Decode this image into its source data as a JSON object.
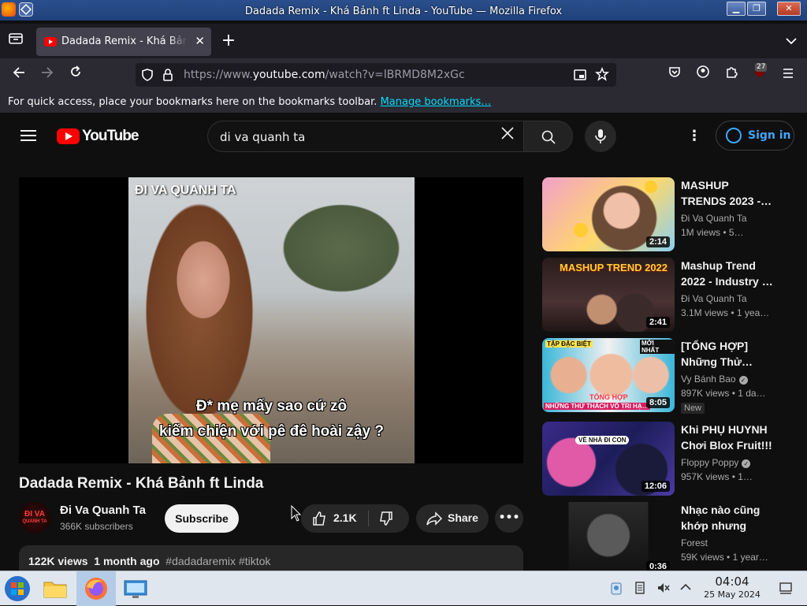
{
  "window": {
    "title": "Dadada Remix - Khá Bảnh ft Linda - YouTube — Mozilla Firefox"
  },
  "tab": {
    "label": "Dadada Remix - Khá Bảnh",
    "close": "✕",
    "new_tab": "+"
  },
  "urlbar": {
    "scheme_host_prefix": "https://www.",
    "domain": "youtube.com",
    "path": "/watch?v=lBRMD8M2xGc"
  },
  "toolbar": {
    "extensions_badge": "27"
  },
  "bookmarks": {
    "message": "For quick access, place your bookmarks here on the bookmarks toolbar.",
    "link": "Manage bookmarks…"
  },
  "youtube": {
    "logo_text": "YouTube",
    "search_query": "di va quanh ta",
    "sign_in": "Sign in"
  },
  "video": {
    "overlay_title": "ĐI VA QUANH TA",
    "subtitle_line1": "Đ* mẹ mấy sao cứ zô",
    "subtitle_line2": "kiếm chiện với pê đê hoài zậy ?",
    "title": "Dadada Remix - Khá Bảnh ft Linda",
    "channel_avatar_text_1": "ĐI VA",
    "channel_avatar_text_2": "QUANH TA",
    "channel": "Đi Va Quanh Ta",
    "subscribers": "366K subscribers",
    "subscribe": "Subscribe",
    "likes": "2.1K",
    "share": "Share",
    "more": "•••",
    "views": "122K views",
    "age": "1 month ago",
    "hashtags": "#dadadaremix #tiktok"
  },
  "recommendations": [
    {
      "title": "MASHUP TRENDS 2023 -…",
      "channel": "Đi Va Quanh Ta",
      "meta": "1M views • 5…",
      "duration": "2:14",
      "verified": false,
      "badge": ""
    },
    {
      "title": "Mashup Trend 2022 - Industry …",
      "channel": "Đi Va Quanh Ta",
      "meta": "3.1M views • 1 yea…",
      "duration": "2:41",
      "thumb_text": "MASHUP TREND 2022",
      "verified": false,
      "badge": ""
    },
    {
      "title": "[TỔNG HỢP] Những Thử…",
      "channel": "Vy Bánh Bao",
      "meta": "897K views • 1 da…",
      "duration": "8:05",
      "thumb_text_1": "TẬP ĐẶC BIỆT",
      "thumb_text_2": "MỚI NHẤT",
      "thumb_text_3": "TỔNG HỢP",
      "thumb_text_4": "NHỮNG THỬ THÁCH VÔ TRI HẠ…",
      "verified": true,
      "badge": "New"
    },
    {
      "title": "Khi PHỤ HUYNH Chơi Blox Fruit!!!",
      "channel": "Floppy Poppy",
      "meta": "957K views • 1…",
      "duration": "12:06",
      "thumb_text": "VỀ NHÀ ĐI CON",
      "verified": true,
      "badge": ""
    },
    {
      "title": "Nhạc nào cũng khớp nhưng nhạ…",
      "channel": "Forest",
      "meta": "59K views • 1 year…",
      "duration": "0:36",
      "verified": false,
      "badge": ""
    }
  ],
  "taskbar": {
    "time": "04:04",
    "date": "25 May 2024"
  },
  "colors": {
    "youtube_red": "#ff0000",
    "page_bg": "#0f0f0f",
    "link_blue": "#3ea6ff",
    "firefox_link": "#00ddff"
  }
}
